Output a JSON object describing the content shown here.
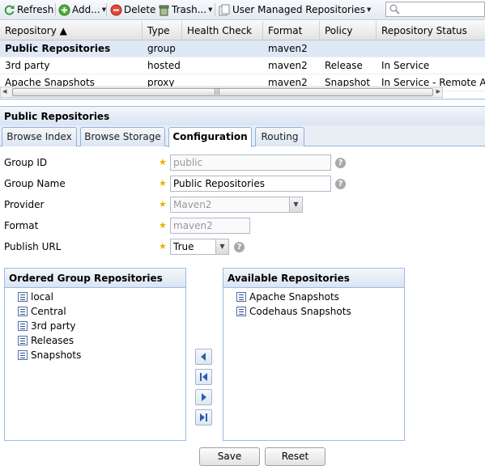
{
  "toolbar": {
    "refresh_label": "Refresh",
    "add_label": "Add...",
    "delete_label": "Delete",
    "trash_label": "Trash...",
    "user_managed_label": "User Managed Repositories",
    "search_placeholder": ""
  },
  "grid": {
    "columns": [
      "Repository ▲",
      "Type",
      "Health Check",
      "Format",
      "Policy",
      "Repository Status"
    ],
    "rows": [
      {
        "repository": "Public Repositories",
        "type": "group",
        "health": "",
        "format": "maven2",
        "policy": "",
        "status": ""
      },
      {
        "repository": "3rd party",
        "type": "hosted",
        "health": "",
        "format": "maven2",
        "policy": "Release",
        "status": "In Service"
      },
      {
        "repository": "Apache Snapshots",
        "type": "proxy",
        "health": "",
        "format": "maven2",
        "policy": "Snapshot",
        "status": "In Service - Remote Aut"
      }
    ]
  },
  "panel": {
    "title": "Public Repositories",
    "tabs": [
      "Browse Index",
      "Browse Storage",
      "Configuration",
      "Routing"
    ],
    "active_tab": "Configuration"
  },
  "form": {
    "group_id_label": "Group ID",
    "group_id_value": "public",
    "group_name_label": "Group Name",
    "group_name_value": "Public Repositories",
    "provider_label": "Provider",
    "provider_value": "Maven2",
    "format_label": "Format",
    "format_value": "maven2",
    "publish_url_label": "Publish URL",
    "publish_url_value": "True",
    "required_marker": "★",
    "help_marker": "?"
  },
  "ordered": {
    "title": "Ordered Group Repositories",
    "items": [
      "local",
      "Central",
      "3rd party",
      "Releases",
      "Snapshots"
    ]
  },
  "available": {
    "title": "Available Repositories",
    "items": [
      "Apache Snapshots",
      "Codehaus Snapshots"
    ]
  },
  "buttons": {
    "save": "Save",
    "reset": "Reset"
  },
  "colors": {
    "selection": "#dfe8f6",
    "border_blue": "#99bbe8",
    "star": "#e8b100"
  }
}
